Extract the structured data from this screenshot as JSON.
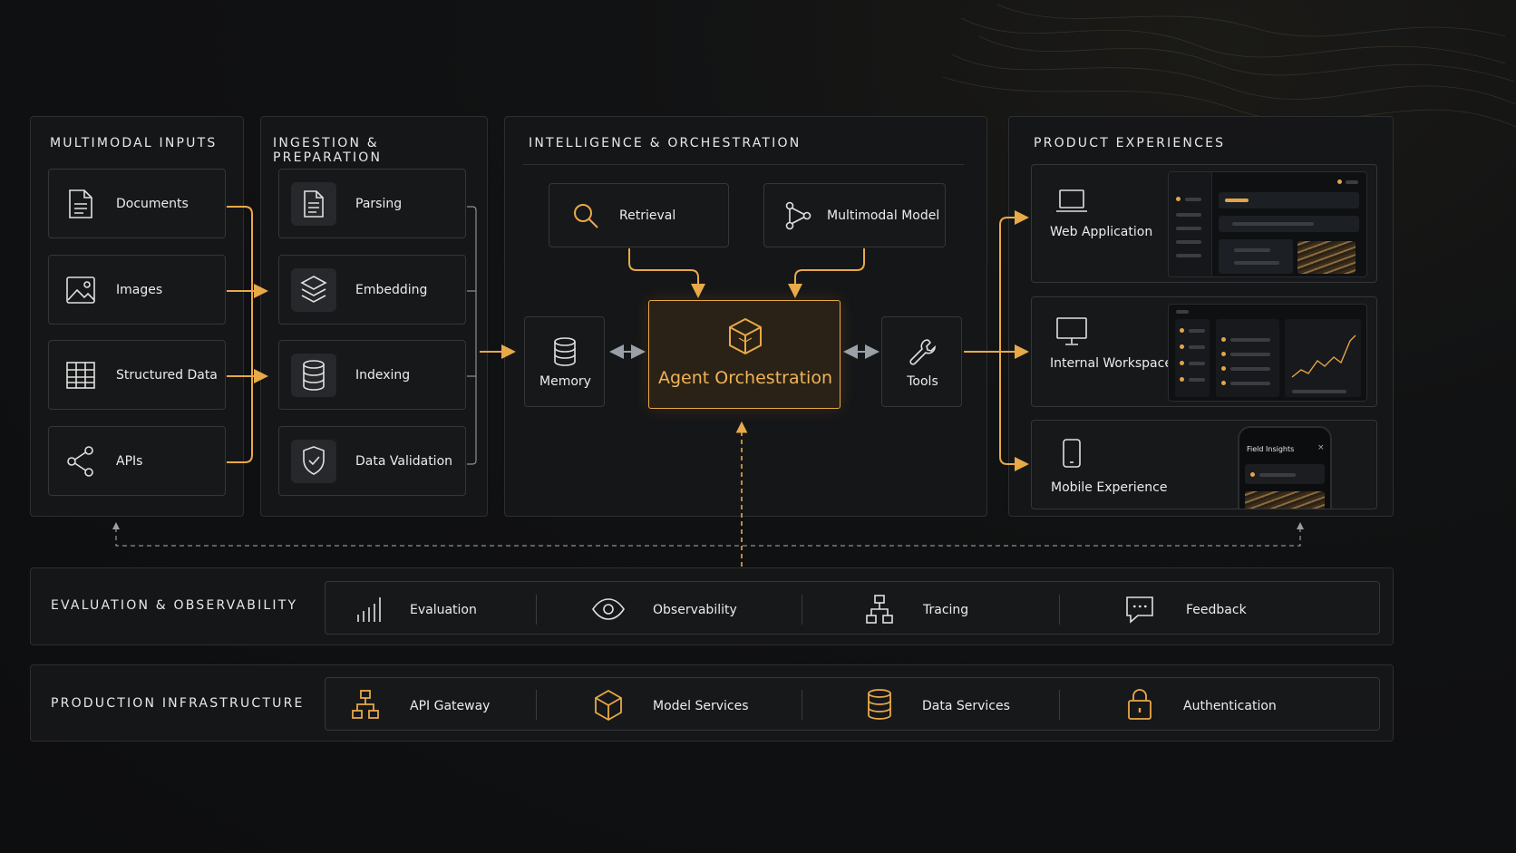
{
  "colors": {
    "accent": "#e8a948",
    "background": "#0d0e10",
    "panel": "#16171a",
    "arrow_gray": "#9aa0a8"
  },
  "sections": {
    "inputs": {
      "title": "MULTIMODAL INPUTS",
      "items": [
        {
          "label": "Documents",
          "icon": "document-icon"
        },
        {
          "label": "Images",
          "icon": "image-icon"
        },
        {
          "label": "Structured Data",
          "icon": "table-icon"
        },
        {
          "label": "APIs",
          "icon": "share-icon"
        }
      ]
    },
    "ingestion": {
      "title": "INGESTION & PREPARATION",
      "items": [
        {
          "label": "Parsing",
          "icon": "document-icon"
        },
        {
          "label": "Embedding",
          "icon": "layers-icon"
        },
        {
          "label": "Indexing",
          "icon": "database-icon"
        },
        {
          "label": "Data Validation",
          "icon": "shield-check-icon"
        }
      ]
    },
    "intelligence": {
      "title": "INTELLIGENCE & ORCHESTRATION",
      "retrieval": "Retrieval",
      "model": "Multimodal Model",
      "memory": "Memory",
      "core": "Agent Orchestration",
      "tools": "Tools"
    },
    "products": {
      "title": "PRODUCT EXPERIENCES",
      "items": [
        {
          "label": "Web Application",
          "icon": "laptop-icon"
        },
        {
          "label": "Internal Workspace",
          "icon": "monitor-icon"
        },
        {
          "label": "Mobile Experience",
          "icon": "phone-icon"
        }
      ],
      "mobile_header": "Field Insights"
    }
  },
  "evaluation": {
    "title": "EVALUATION & OBSERVABILITY",
    "items": [
      {
        "label": "Evaluation",
        "icon": "bar-chart-icon"
      },
      {
        "label": "Observability",
        "icon": "eye-icon"
      },
      {
        "label": "Tracing",
        "icon": "hierarchy-icon"
      },
      {
        "label": "Feedback",
        "icon": "chat-icon"
      }
    ]
  },
  "infrastructure": {
    "title": "PRODUCTION INFRASTRUCTURE",
    "items": [
      {
        "label": "API Gateway",
        "icon": "network-icon"
      },
      {
        "label": "Model Services",
        "icon": "cube-icon"
      },
      {
        "label": "Data Services",
        "icon": "database-icon"
      },
      {
        "label": "Authentication",
        "icon": "lock-icon"
      }
    ]
  }
}
